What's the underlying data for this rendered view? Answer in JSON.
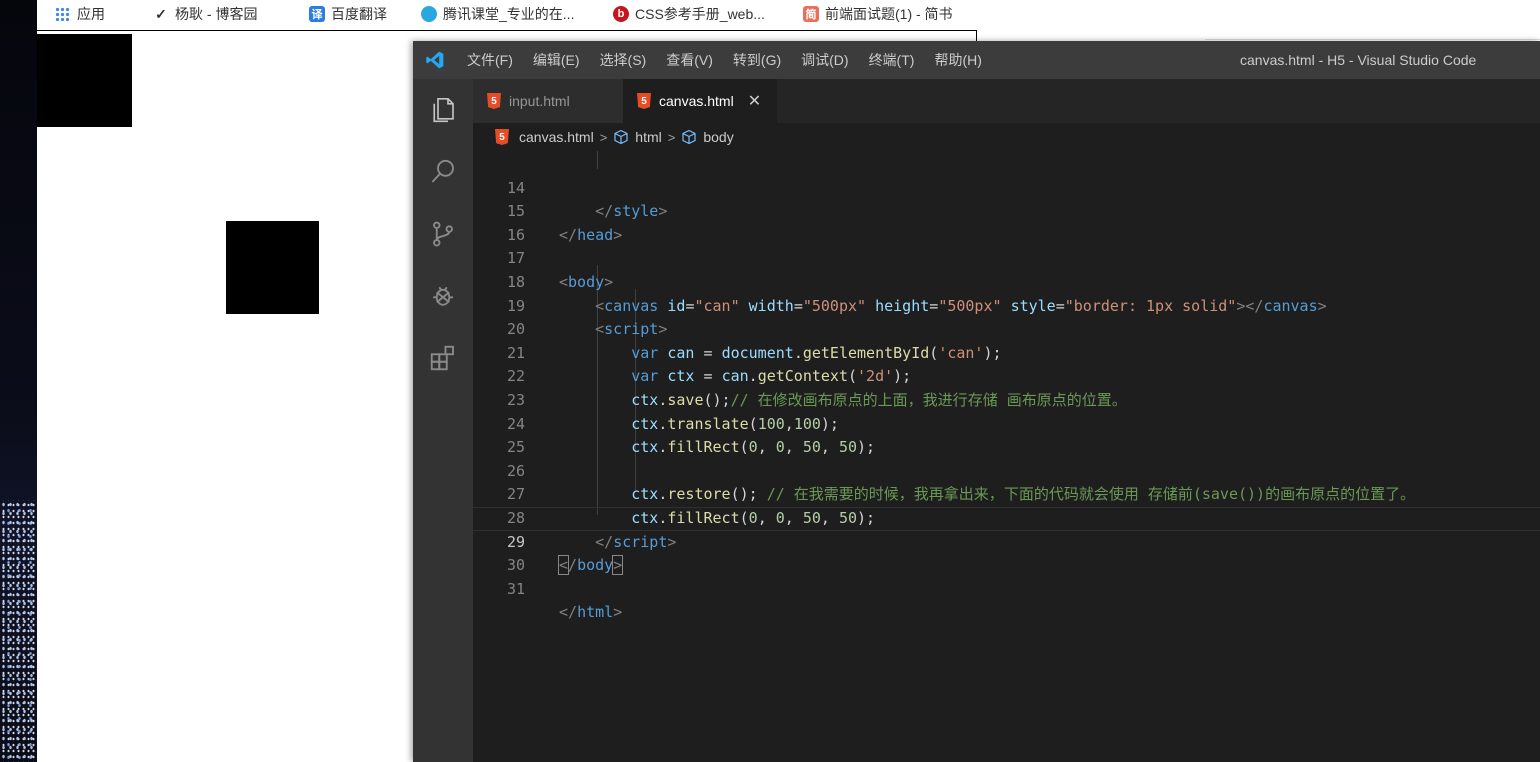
{
  "bookmarks": [
    {
      "label": "应用",
      "icon": "apps-grid-icon"
    },
    {
      "label": "杨耿 - 博客园",
      "icon": "cnblogs-icon"
    },
    {
      "label": "百度翻译",
      "icon": "baidu-translate-icon"
    },
    {
      "label": "腾讯课堂_专业的在...",
      "icon": "tencent-classroom-icon"
    },
    {
      "label": "CSS参考手册_web...",
      "icon": "css-manual-icon"
    },
    {
      "label": "前端面试题(1) - 简书",
      "icon": "jianshu-icon"
    }
  ],
  "vscode": {
    "window_title": "canvas.html - H5 - Visual Studio Code",
    "menu": [
      "文件(F)",
      "编辑(E)",
      "选择(S)",
      "查看(V)",
      "转到(G)",
      "调试(D)",
      "终端(T)",
      "帮助(H)"
    ],
    "activity_bar": [
      "explorer-icon",
      "search-icon",
      "source-control-icon",
      "debug-icon",
      "extensions-icon"
    ],
    "tabs": [
      {
        "label": "input.html",
        "active": false
      },
      {
        "label": "canvas.html",
        "active": true
      }
    ],
    "breadcrumb": [
      "canvas.html",
      "html",
      "body"
    ],
    "current_line": "29",
    "line_numbers": [
      "14",
      "15",
      "16",
      "17",
      "18",
      "19",
      "20",
      "21",
      "22",
      "23",
      "24",
      "25",
      "26",
      "27",
      "28",
      "29",
      "30",
      "31"
    ]
  },
  "colors": {
    "titlebar": "#3c3c3c",
    "activitybar": "#333333",
    "editor_bg": "#1e1e1e",
    "tag_name": "#569cd6",
    "attribute": "#9cdcfe",
    "string": "#ce9178",
    "function": "#dcdcaa",
    "number": "#b5cea8",
    "comment": "#6a9955"
  }
}
